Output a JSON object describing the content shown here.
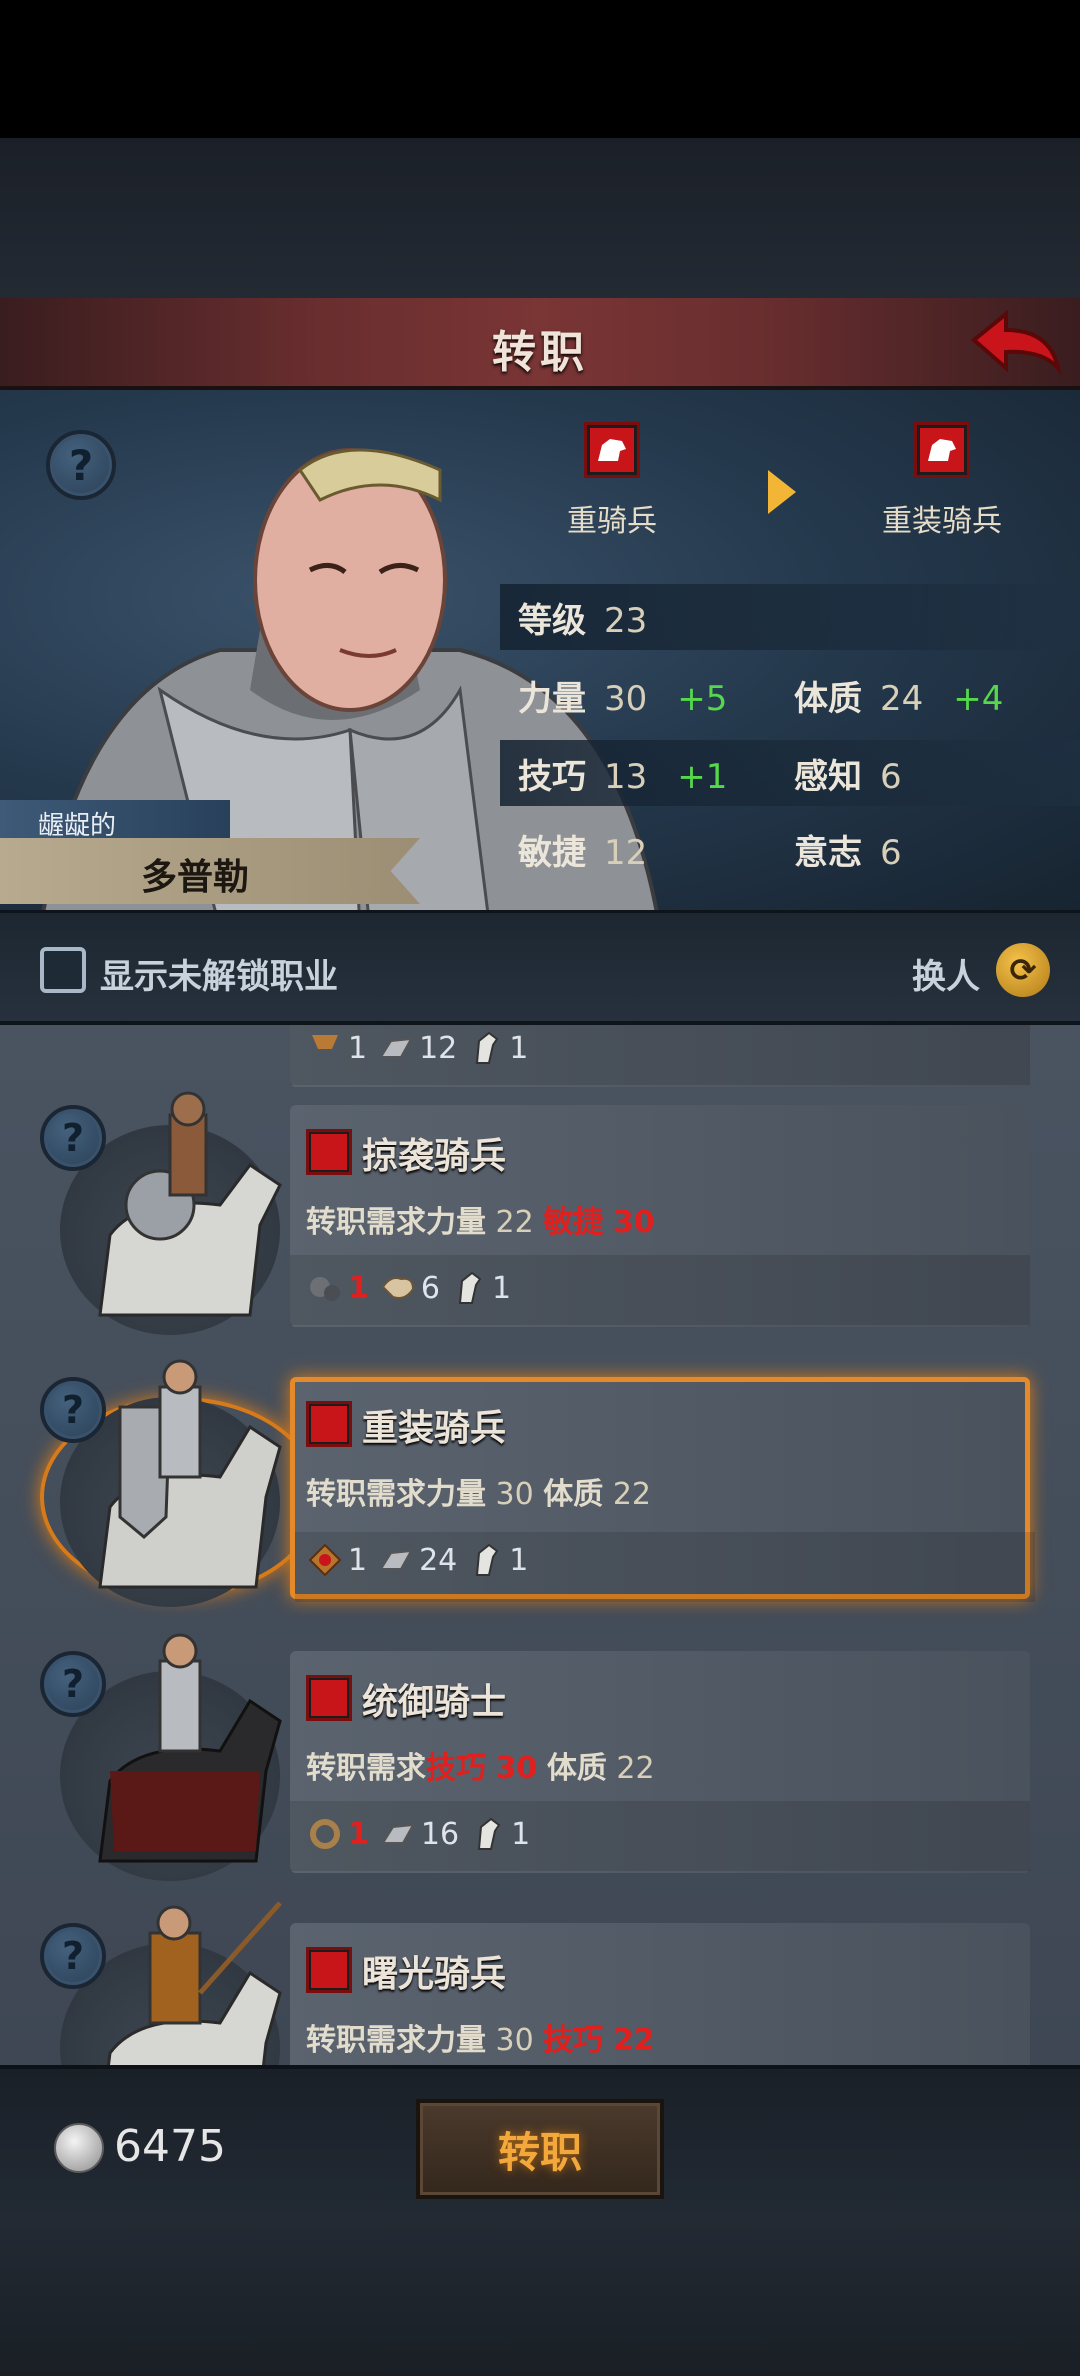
{
  "header": {
    "title": "转职"
  },
  "hero": {
    "title_prefix": "龌龊的",
    "name": "多普勒",
    "from_class": "重骑兵",
    "to_class": "重装骑兵",
    "stats": {
      "level_label": "等级",
      "level": "23",
      "str_label": "力量",
      "str": "30",
      "str_bonus": "+5",
      "con_label": "体质",
      "con": "24",
      "con_bonus": "+4",
      "skill_label": "技巧",
      "skill": "13",
      "skill_bonus": "+1",
      "per_label": "感知",
      "per": "6",
      "agi_label": "敏捷",
      "agi": "12",
      "will_label": "意志",
      "will": "6"
    }
  },
  "options": {
    "show_locked_label": "显示未解锁职业",
    "swap_label": "换人"
  },
  "classes": [
    {
      "name": "",
      "partial": true,
      "costs": [
        {
          "icon": "medal-icon",
          "count": "1"
        },
        {
          "icon": "iron-bar-icon",
          "count": "12"
        },
        {
          "icon": "horse-icon",
          "count": "1"
        }
      ]
    },
    {
      "name": "掠袭骑兵",
      "req_prefix": "转职需求",
      "reqs": [
        {
          "label": "力量",
          "value": "22",
          "met": true
        },
        {
          "label": "敏捷",
          "value": "30",
          "met": false
        }
      ],
      "costs": [
        {
          "icon": "iron-balls-icon",
          "count": "1",
          "met": false
        },
        {
          "icon": "leather-icon",
          "count": "6",
          "met": true
        },
        {
          "icon": "horse-icon",
          "count": "1",
          "met": true
        }
      ]
    },
    {
      "name": "重装骑兵",
      "selected": true,
      "req_prefix": "转职需求",
      "reqs": [
        {
          "label": "力量",
          "value": "30",
          "met": true
        },
        {
          "label": "体质",
          "value": "22",
          "met": true
        }
      ],
      "costs": [
        {
          "icon": "medal-icon",
          "count": "1",
          "met": true
        },
        {
          "icon": "iron-bar-icon",
          "count": "24",
          "met": true
        },
        {
          "icon": "horse-icon",
          "count": "1",
          "met": true
        }
      ]
    },
    {
      "name": "统御骑士",
      "req_prefix": "转职需求",
      "reqs": [
        {
          "label": "技巧",
          "value": "30",
          "met": false
        },
        {
          "label": "体质",
          "value": "22",
          "met": true
        }
      ],
      "costs": [
        {
          "icon": "ring-icon",
          "count": "1",
          "met": false
        },
        {
          "icon": "iron-bar-icon",
          "count": "16",
          "met": true
        },
        {
          "icon": "horse-icon",
          "count": "1",
          "met": true
        }
      ]
    },
    {
      "name": "曙光骑兵",
      "req_prefix": "转职需求",
      "reqs": [
        {
          "label": "力量",
          "value": "30",
          "met": true
        },
        {
          "label": "技巧",
          "value": "22",
          "met": false
        }
      ],
      "costs": []
    }
  ],
  "footer": {
    "coins": "6475",
    "confirm_label": "转职"
  },
  "colors": {
    "accent": "#f3b535",
    "bad": "#e0201e",
    "good": "#55d84a",
    "select": "#e58a2a"
  }
}
